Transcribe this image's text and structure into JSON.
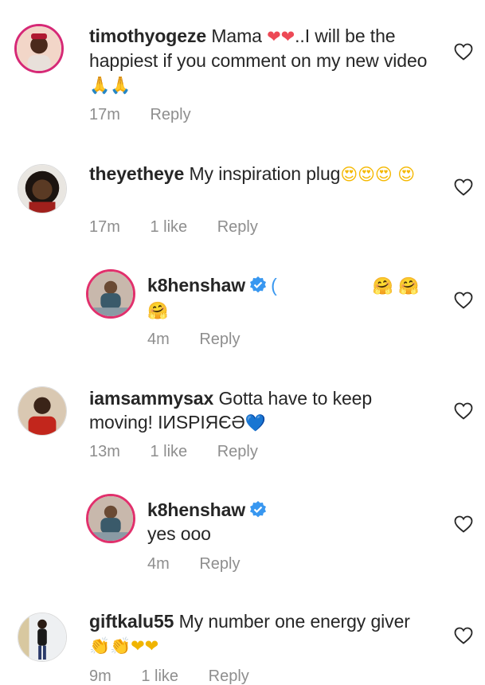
{
  "comments": [
    {
      "username": "timothyogeze",
      "text_before": "Mama",
      "emoji_a": "❤❤",
      "text_after": "..I will be the happiest if you comment on my new video",
      "emoji_b": "🙏🙏",
      "time": "17m",
      "reply": "Reply"
    },
    {
      "username": "theyetheye",
      "text": "My inspiration plug",
      "emoji": "😍😍😍 😍",
      "time": "17m",
      "likes": "1 like",
      "reply": "Reply"
    },
    {
      "username": "k8henshaw",
      "text": "(",
      "emoji": "🤗 🤗🤗",
      "time": "4m",
      "reply": "Reply"
    },
    {
      "username": "iamsammysax",
      "text": "Gotta have to keep moving! IИSPIЯЄƏ",
      "emoji": "💙",
      "time": "13m",
      "likes": "1 like",
      "reply": "Reply"
    },
    {
      "username": "k8henshaw",
      "text": "yes ooo",
      "time": "4m",
      "reply": "Reply"
    },
    {
      "username": "giftkalu55",
      "text": "My number one energy giver",
      "emoji": "👏👏❤❤",
      "time": "9m",
      "likes": "1 like",
      "reply": "Reply"
    }
  ],
  "icons": {
    "like": "heart-outline-icon",
    "verified": "verified-badge-icon"
  },
  "colors": {
    "text": "#262626",
    "meta": "#8e8e8e",
    "verified": "#3897f0",
    "story_ring_start": "#f9a51b",
    "story_ring_end": "#c0237d"
  }
}
